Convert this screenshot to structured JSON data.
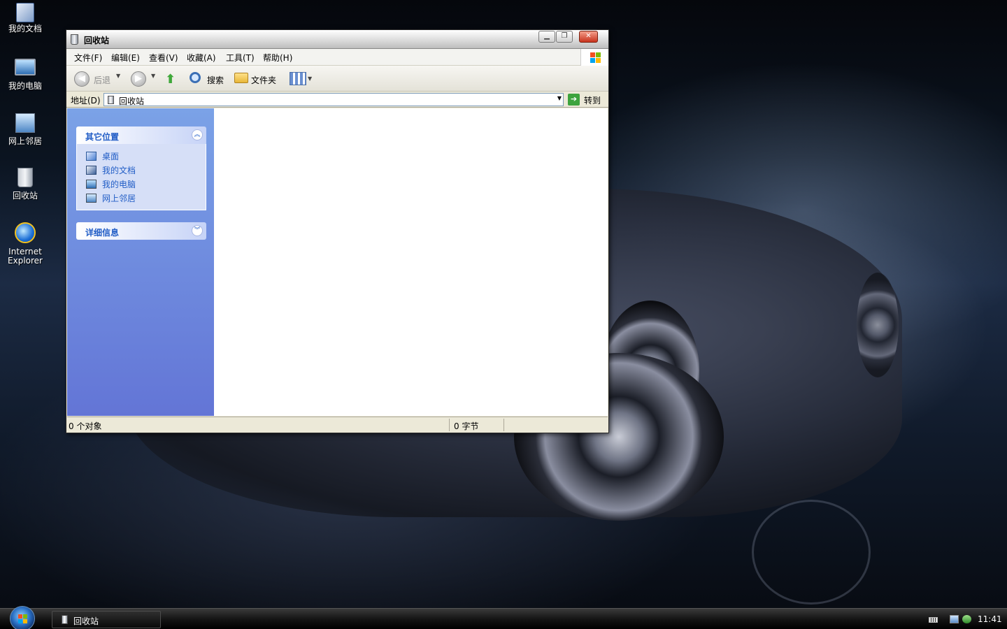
{
  "desktop": {
    "icons": [
      {
        "label": "我的文档"
      },
      {
        "label": "我的电脑"
      },
      {
        "label": "网上邻居"
      },
      {
        "label": "回收站"
      },
      {
        "label": "Internet Explorer"
      }
    ]
  },
  "window": {
    "title": "回收站",
    "menu": [
      "文件(F)",
      "编辑(E)",
      "查看(V)",
      "收藏(A)",
      "工具(T)",
      "帮助(H)"
    ],
    "toolbar": {
      "back": "后退",
      "search": "搜索",
      "folders": "文件夹"
    },
    "address": {
      "label": "地址(D)",
      "value": "回收站",
      "go": "转到"
    },
    "taskpane": {
      "other_places": {
        "title": "其它位置",
        "links": [
          "桌面",
          "我的文档",
          "我的电脑",
          "网上邻居"
        ]
      },
      "details": {
        "title": "详细信息"
      }
    },
    "status": {
      "objects": "0 个对象",
      "size": "0 字节"
    }
  },
  "taskbar": {
    "task": "回收站",
    "clock": "11:41"
  },
  "colors": {
    "link_blue": "#215dc6",
    "taskpane_top": "#7ba2e7",
    "taskpane_bottom": "#6375d6"
  }
}
